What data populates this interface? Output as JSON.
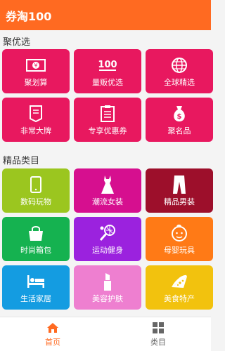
{
  "header": {
    "title": "券淘100"
  },
  "sections": [
    {
      "title": "聚优选",
      "tiles": [
        {
          "label": "聚划算",
          "icon": "money-icon",
          "color": "#e8185f"
        },
        {
          "label": "量贩优选",
          "icon": "100-icon",
          "color": "#e8185f"
        },
        {
          "label": "全球精选",
          "icon": "globe-icon",
          "color": "#e8185f"
        },
        {
          "label": "非常大牌",
          "icon": "certificate-icon",
          "color": "#e8185f"
        },
        {
          "label": "专享优惠券",
          "icon": "clipboard-icon",
          "color": "#e8185f"
        },
        {
          "label": "聚名品",
          "icon": "money-bag-icon",
          "color": "#e8185f"
        }
      ]
    },
    {
      "title": "精品类目",
      "tiles": [
        {
          "label": "数码玩物",
          "icon": "tablet-icon",
          "color": "#9bc61f"
        },
        {
          "label": "潮流女装",
          "icon": "dress-icon",
          "color": "#d60f8f"
        },
        {
          "label": "精品男装",
          "icon": "trousers-icon",
          "color": "#9d0f2b"
        },
        {
          "label": "时尚箱包",
          "icon": "handbag-icon",
          "color": "#15b250"
        },
        {
          "label": "运动健身",
          "icon": "tennis-icon",
          "color": "#9b22de"
        },
        {
          "label": "母婴玩具",
          "icon": "baby-icon",
          "color": "#ff7a16"
        },
        {
          "label": "生活家居",
          "icon": "bed-icon",
          "color": "#149ce1"
        },
        {
          "label": "美容护肤",
          "icon": "lipstick-icon",
          "color": "#ee7fd0"
        },
        {
          "label": "美食特产",
          "icon": "pizza-icon",
          "color": "#f2c20e"
        }
      ]
    }
  ],
  "nav": [
    {
      "label": "首页",
      "icon": "home-icon",
      "active": true,
      "color": "#ff6a21"
    },
    {
      "label": "类目",
      "icon": "grid-icon",
      "active": false,
      "color": "#666666"
    }
  ]
}
